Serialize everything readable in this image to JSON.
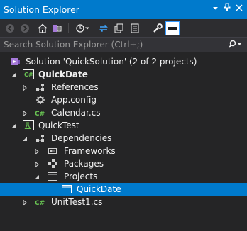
{
  "window": {
    "title": "Solution Explorer",
    "dropdown_glyph": "▾",
    "pin_glyph": "📌",
    "close_glyph": "✕"
  },
  "toolbar": {
    "items": [
      "back-icon",
      "forward-icon",
      "home-icon",
      "switch-views-icon",
      "pending-changes-filter-icon",
      "sync-active-document-icon",
      "refresh-icon",
      "collapse-all-icon",
      "show-all-files-icon",
      "properties-icon",
      "preview-selected-items-icon"
    ]
  },
  "search": {
    "placeholder": "Search Solution Explorer (Ctrl+;)"
  },
  "tree": {
    "solution": "Solution 'QuickSolution' (2 of 2 projects)",
    "quickdate_project": "QuickDate",
    "references": "References",
    "app_config": "App.config",
    "calendar_cs": "Calendar.cs",
    "quicktest_project": "QuickTest",
    "dependencies": "Dependencies",
    "frameworks": "Frameworks",
    "packages": "Packages",
    "projects": "Projects",
    "quickdate_ref": "QuickDate",
    "unittest_cs": "UnitTest1.cs"
  },
  "colors": {
    "accent": "#007acc",
    "background": "#252526",
    "csharp": "#68c252",
    "solution": "#a67ad9"
  }
}
